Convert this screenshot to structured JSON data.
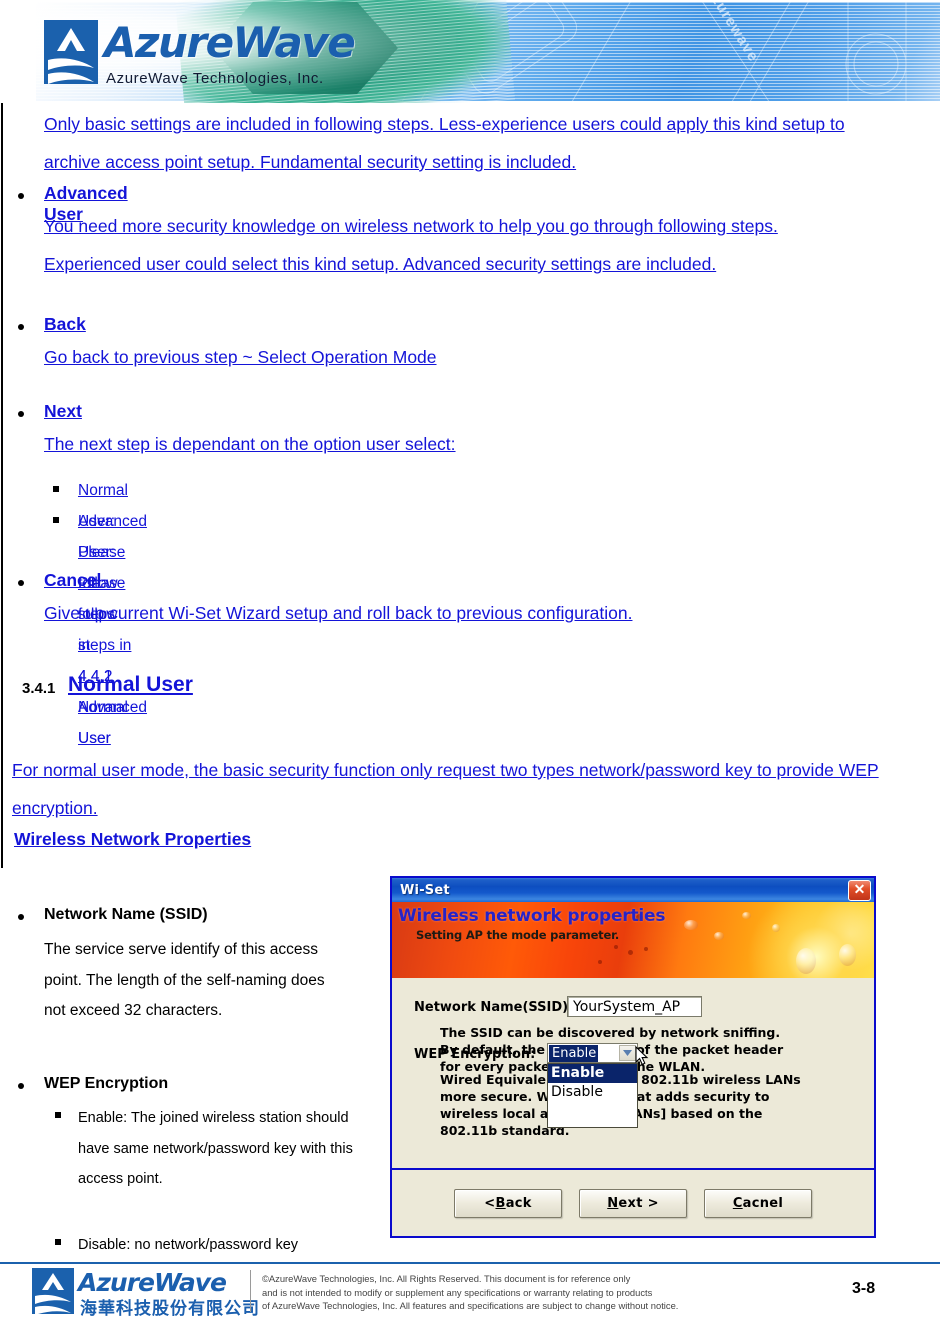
{
  "header": {
    "logo_text": "AzureWave",
    "logo_sub": "AzureWave  Technologies,  Inc.",
    "watermark": "azurewave"
  },
  "doc": {
    "intro_paragraph": "Only basic settings are included in following steps. Less-experience users could apply this kind setup to archive access point setup. Fundamental security setting is included.",
    "bullets": [
      {
        "title": "Advanced User",
        "body": "You need more security knowledge on wireless network to help you go through following steps. Experienced user could select this kind setup. Advanced security settings are included."
      },
      {
        "title": "Back",
        "body": "Go back to previous step ~ Select Operation Mode"
      },
      {
        "title": "Next ",
        "body": "The next step is dependant on the option user select:",
        "subitems": [
          "Normal User: Please follow steps in 4.4.1 Normal User",
          "Advanced User: Please follow steps in 4.4.2 Advanced User"
        ]
      },
      {
        "title": "Cancel",
        "body": "Give up current Wi-Set Wizard setup and roll back to previous configuration."
      }
    ],
    "section_number": "3.4.1",
    "section_title": "Normal User",
    "section_intro": "For normal user mode, the basic security function only request two types network/password key to provide WEP encryption.",
    "subsection_title": "Wireless Network Properties"
  },
  "left_list": [
    {
      "title": "Network Name (SSID)",
      "body": "The service serve identify of this access point. The length of the self-naming does not exceed 32 characters."
    },
    {
      "title": "WEP Encryption",
      "subitems": [
        "Enable: The joined wireless station should have same network/password key with this access point.",
        "Disable: no network/password key"
      ]
    }
  ],
  "dialog": {
    "title": "Wi-Set",
    "close_label": "✕",
    "banner_title": "Wireless network properties",
    "banner_subtitle": "Setting AP the mode parameter.",
    "ssid_label": "Network Name(SSID):",
    "ssid_value": "YourSystem_AP",
    "ssid_help_line1": "The SSID can be discovered by network sniffing.",
    "ssid_help_line2": "By default, the SSID is part of the packet header",
    "ssid_help_line3": "for every packet sent over the WLAN.",
    "wep_label": "WEP Encryption:",
    "wep_selected": "Enable",
    "wep_options": [
      "Enable",
      "Disable"
    ],
    "wep_help_line1": "Wired Equivalent Privacy makes 802.11b wireless LANs",
    "wep_help_line2": "more secure. WEP is a protocol that adds security to",
    "wep_help_line3": "wireless local area networks (WLANs) based on the",
    "wep_help_line4": "802.11b standard.",
    "wep_help_visible_1_tail": "kes 802.11b wireless LANs",
    "wep_help_visible_2_head": "more secure. W",
    "wep_help_visible_2_tail": "l that adds security to",
    "wep_help_visible_3_head": "wireless local a",
    "wep_help_visible_3_tail": "VLANs] based on the",
    "wep_help_visible_1_head": "Wired Equivalen",
    "wep_help_visible_4": "802.11b standard.",
    "buttons": {
      "back": "< Back",
      "back_pre": "< ",
      "back_accel": "B",
      "back_post": "ack",
      "next_pre": "",
      "next_accel": "N",
      "next_post": "ext >",
      "cancel_accel": "C",
      "cancel_post": "acnel"
    }
  },
  "footer": {
    "logo_text": "AzureWave",
    "logo_cn": "海華科技股份有限公司",
    "legal_line1": "©AzureWave Technologies, Inc. All Rights Reserved. This document is for reference only",
    "legal_line2": "and is not intended to modify or supplement any specifications or  warranty relating to products",
    "legal_line3": "of AzureWave Technologies, Inc.  All features and specifications are subject to change without notice.",
    "page_number": "3-8"
  },
  "colors": {
    "link": "#1414d8",
    "brand_blue": "#1b5fae",
    "dialog_border": "#0a0acd",
    "dialog_face": "#ece9d8",
    "select_blue": "#0a246a"
  }
}
